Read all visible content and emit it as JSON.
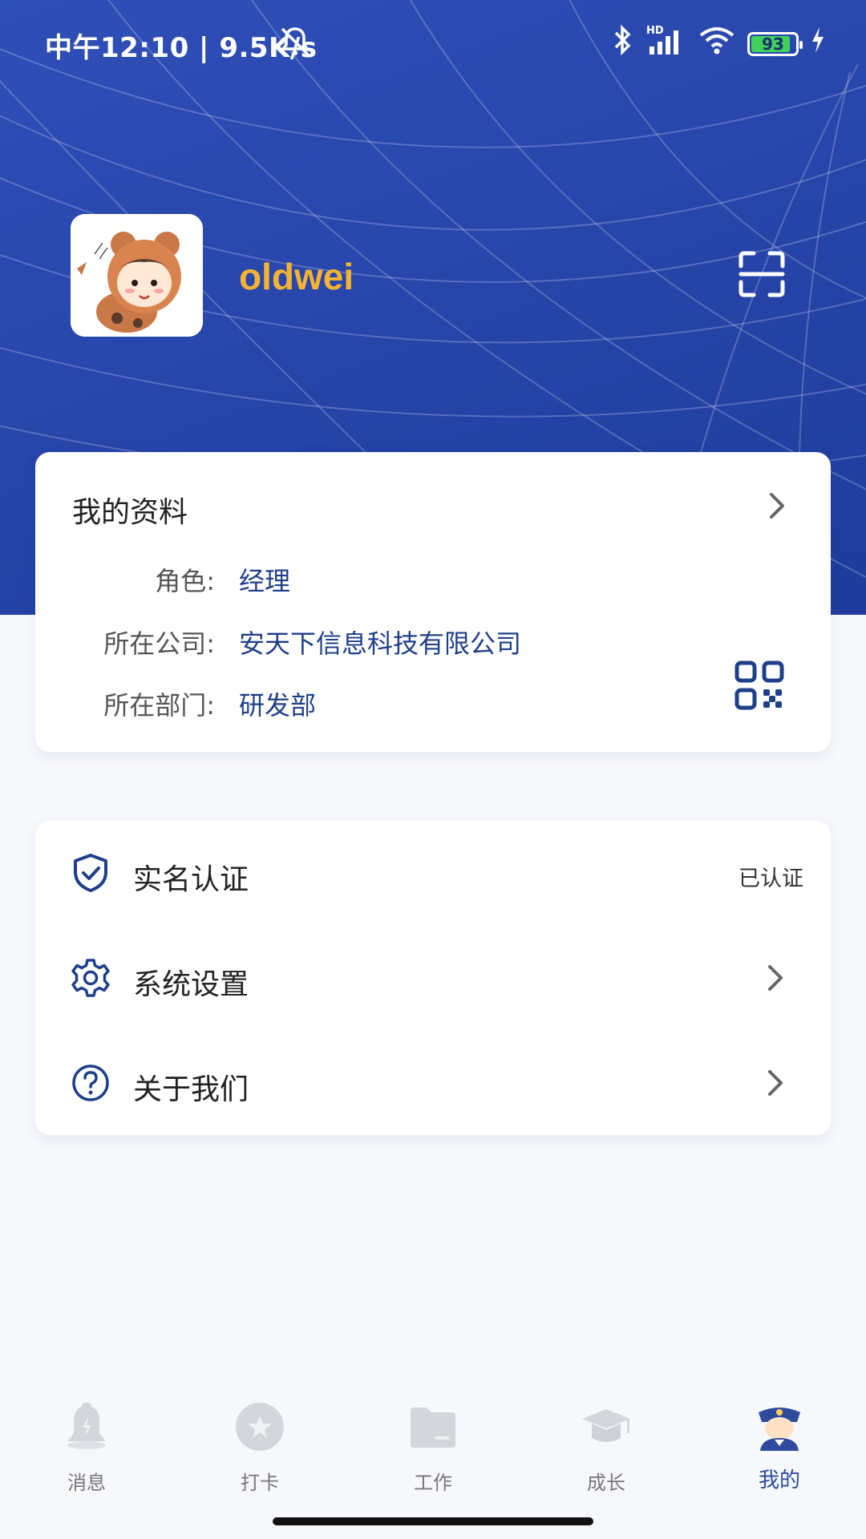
{
  "status_bar": {
    "time": "中午12:10 | 9.5K/s",
    "battery": "93",
    "network": "HD"
  },
  "profile": {
    "username": "oldwei"
  },
  "profile_card": {
    "title": "我的资料",
    "rows": [
      {
        "label": "角色:",
        "value": "经理"
      },
      {
        "label": "所在公司:",
        "value": "安天下信息科技有限公司"
      },
      {
        "label": "所在部门:",
        "value": "研发部"
      }
    ]
  },
  "menu": {
    "items": [
      {
        "label": "实名认证",
        "status": "已认证",
        "icon": "shield-check-icon"
      },
      {
        "label": "系统设置",
        "status": "",
        "icon": "gear-icon"
      },
      {
        "label": "关于我们",
        "status": "",
        "icon": "question-icon"
      }
    ]
  },
  "tabbar": {
    "tabs": [
      {
        "label": "消息",
        "icon": "bell-icon"
      },
      {
        "label": "打卡",
        "icon": "star-badge-icon"
      },
      {
        "label": "工作",
        "icon": "folder-icon"
      },
      {
        "label": "成长",
        "icon": "graduation-cap-icon"
      },
      {
        "label": "我的",
        "icon": "police-avatar-icon"
      }
    ],
    "active_index": 4
  },
  "colors": {
    "header_blue": "#2846ab",
    "username_gold": "#f5b332",
    "value_blue": "#1f3f8a",
    "active_tab": "#2d4a9c"
  }
}
